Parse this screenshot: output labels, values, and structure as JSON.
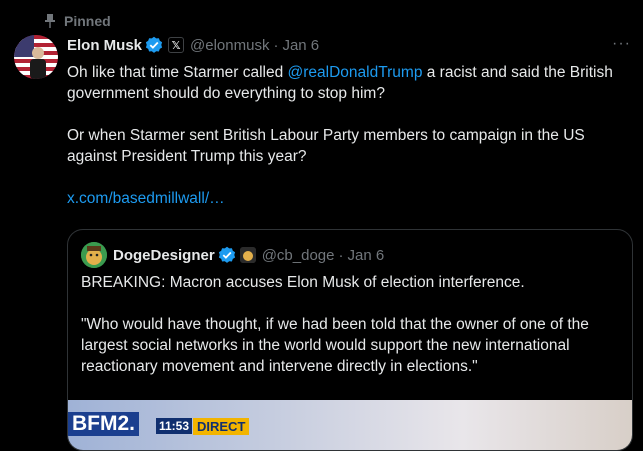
{
  "pinned": {
    "label": "Pinned"
  },
  "tweet": {
    "display_name": "Elon Musk",
    "x_badge": "𝕏",
    "handle": "@elonmusk",
    "separator": "·",
    "date": "Jan 6",
    "more": "···",
    "text": {
      "line1_pre": "Oh like that time Starmer called ",
      "mention": "@realDonaldTrump",
      "line1_post": " a racist and said the British government should do everything to stop him?",
      "para2": "Or when Starmer sent British Labour Party members to campaign in the US against President Trump this year?",
      "link": "x.com/basedmillwall/…"
    }
  },
  "quote": {
    "display_name": "DogeDesigner",
    "handle": "@cb_doge",
    "separator": "·",
    "date": "Jan 6",
    "para1": "BREAKING: Macron accuses Elon Musk of election interference.",
    "para2": "\"Who would have thought, if we had been told that the owner of one of the largest social networks in the world would support the new international reactionary movement and intervene directly in elections.\"",
    "media": {
      "logo": "BFM2.",
      "time": "11:53",
      "live": "DIRECT"
    }
  },
  "colors": {
    "accent": "#1d9bf0",
    "muted": "#71767b",
    "border": "#2f3336"
  }
}
